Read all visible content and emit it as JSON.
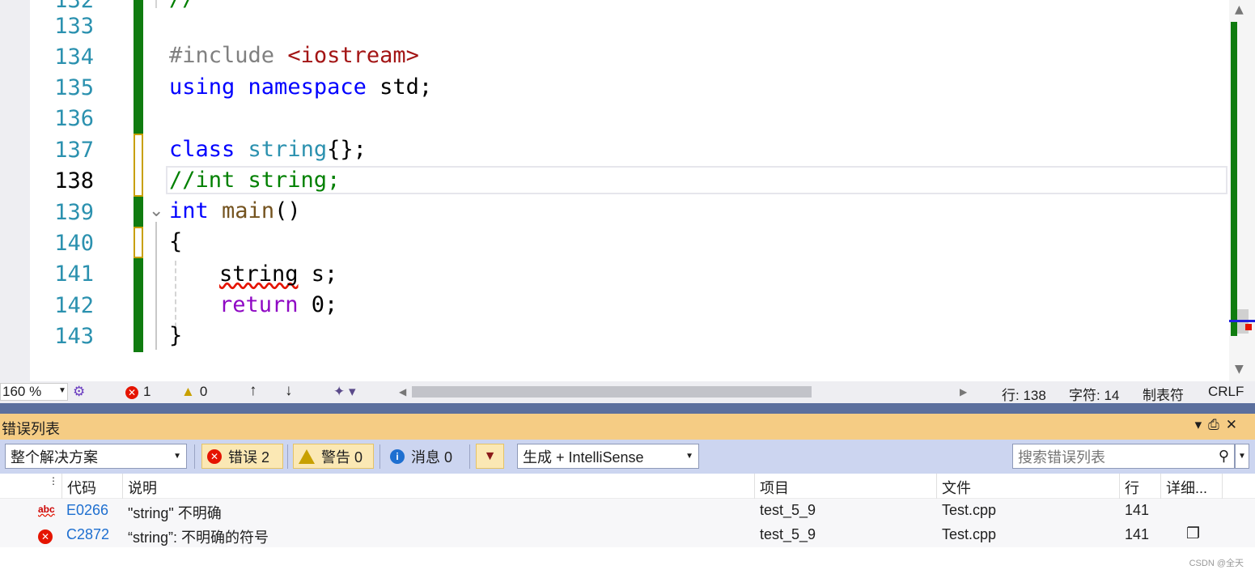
{
  "editor": {
    "line_numbers": [
      "132",
      "133",
      "134",
      "135",
      "136",
      "137",
      "138",
      "139",
      "140",
      "141",
      "142",
      "143"
    ],
    "lines": {
      "l134_a": "#include ",
      "l134_b": "<iostream>",
      "l135_a": "using",
      "l135_b": "namespace",
      "l135_c": " std;",
      "l137_a": "class",
      "l137_b": "string",
      "l137_c": "{};",
      "l138": "//int string;",
      "l139_a": "int",
      "l139_b": "main",
      "l139_c": "()",
      "l140": "{",
      "l141_a": "string",
      "l141_b": " s;",
      "l142_a": "return",
      "l142_b": " 0;",
      "l143": "}",
      "l132": "//"
    },
    "current_line": "138"
  },
  "status": {
    "zoom": "160 %",
    "errors": "1",
    "warnings": "0",
    "line": "行: 138",
    "char": "字符: 14",
    "indent": "制表符",
    "eol": "CRLF"
  },
  "error_list": {
    "title": "错误列表",
    "scope": "整个解决方案",
    "errors_btn": "错误 2",
    "warnings_btn": "警告 0",
    "messages_btn": "消息 0",
    "source": "生成 + IntelliSense",
    "search_placeholder": "搜索错误列表",
    "columns": {
      "code": "代码",
      "desc": "说明",
      "project": "项目",
      "file": "文件",
      "line": "行",
      "detail": "详细..."
    },
    "rows": [
      {
        "code": "E0266",
        "desc": "\"string\" 不明确",
        "project": "test_5_9",
        "file": "Test.cpp",
        "line": "141"
      },
      {
        "code": "C2872",
        "desc": "“string”: 不明确的符号",
        "project": "test_5_9",
        "file": "Test.cpp",
        "line": "141"
      }
    ]
  },
  "watermark": "CSDN @全天",
  "colors": {
    "change_green": "#107c10",
    "panel_title": "#f5cc84",
    "toolbar": "#ccd5f0",
    "error_red": "#e51400"
  }
}
